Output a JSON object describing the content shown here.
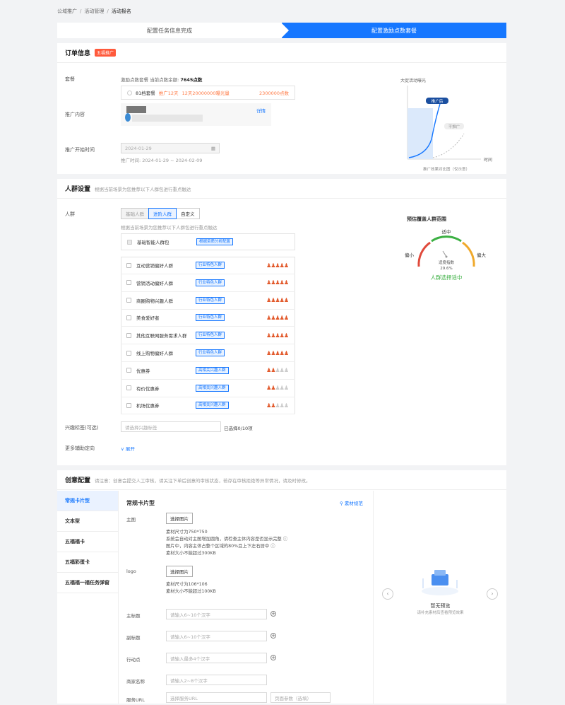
{
  "breadcrumb": {
    "items": [
      "公域推广",
      "活动管理",
      "活动报名"
    ],
    "sep": "/"
  },
  "steps": {
    "step1": "配置任务信息完成",
    "step2": "配置激励点数套餐"
  },
  "order": {
    "title": "订单信息",
    "badge": "五福推广",
    "package_label": "套餐",
    "package_info": "激励点数套餐  当前点数余额:",
    "balance": "7645点数",
    "package_line": {
      "price": "81档套餐",
      "promo": "推广12天",
      "exposure": "12天20000000曝光量",
      "points": "2300000点数"
    },
    "content_label": "推广内容",
    "detail_link": "详情",
    "start_label": "推广开始时间",
    "start_date": "2024-01-29",
    "promo_time": "推广时间: 2024-01-29 ~ 2024-02-09",
    "chart_ylabel": "大促活动曝光",
    "chart_tag1": "推广后",
    "chart_tag2": "平推广",
    "chart_xlabel": "时间",
    "chart_caption": "推广效果对比图（仅示意）"
  },
  "crowd": {
    "title": "人群设置",
    "subtitle": "根据当前场景为您推荐以下人群包进行重点触达",
    "label": "人群",
    "tabs": [
      "基础人群",
      "进阶人群",
      "自定义"
    ],
    "hint": "根据当前场景为您推荐以下人群包进行重点触达",
    "base": {
      "name": "基础智能人群包",
      "tag": "根据资质分析配置"
    },
    "items": [
      {
        "name": "互动营销偏好人群",
        "tag": "行业特色人群",
        "level": 5
      },
      {
        "name": "营销活动偏好人群",
        "tag": "行业特色人群",
        "level": 5
      },
      {
        "name": "商圈购物兴趣人群",
        "tag": "行业特色人群",
        "level": 5
      },
      {
        "name": "美食爱好者",
        "tag": "行业特色人群",
        "level": 5
      },
      {
        "name": "其他互联网服务需求人群",
        "tag": "行业特色人群",
        "level": 5
      },
      {
        "name": "线上购物偏好人群",
        "tag": "行业特色人群",
        "level": 5
      },
      {
        "name": "优惠券",
        "tag": "高相关兴趣人群",
        "level": 2
      },
      {
        "name": "有价优惠券",
        "tag": "高相关兴趣人群",
        "level": 1.5
      },
      {
        "name": "机场优惠券",
        "tag": "高相关兴趣人群",
        "level": 1.5
      }
    ],
    "interest_label": "兴趣标签(可选)",
    "interest_placeholder": "请选择兴趣标签",
    "interest_count": "已选择0/10项",
    "more_label": "更多辅助定向",
    "expand": "展开",
    "gauge": {
      "title": "预估覆盖人群范围",
      "top": "适中",
      "left": "偏小",
      "right": "偏大",
      "index_label": "适度指数",
      "index_value": "29.6%",
      "result": "人群选择适中",
      "colors": {
        "left": "#e04a3c",
        "mid": "#3cb043",
        "right": "#f0a92b"
      }
    }
  },
  "creative": {
    "title": "创意配置",
    "notice": "请注意：创意会提交人工审核，请关注下单后创意的审核状态，若存在审核拒绝等异常情况，请及时修改。",
    "nav": [
      "常规卡片型",
      "文本型",
      "五福福卡",
      "五福彩蛋卡",
      "五福福一福任务弹窗"
    ],
    "form_title": "常规卡片型",
    "spec_link": "素材规范",
    "main_image_label": "主图",
    "select_btn": "选择图片",
    "main_tips": [
      "素材尺寸为750*750",
      "系统会自动对主图增加圆角，请检查主体内容是否显示完整 ⓘ",
      "图片中，内容主体占整个区域的80%且上下左右居中 ⓘ",
      "素材大小不能超过300KB"
    ],
    "logo_label": "logo",
    "logo_tips": [
      "素材尺寸为106*106",
      "素材大小不能超过100KB"
    ],
    "fields": [
      {
        "label": "主标题",
        "placeholder": "请输入6~10个汉字"
      },
      {
        "label": "副标题",
        "placeholder": "请输入6~10个汉字"
      },
      {
        "label": "行动点",
        "placeholder": "请输入最多4个汉字"
      },
      {
        "label": "商家名称",
        "placeholder": "请输入2~8个汉字"
      }
    ],
    "url_label": "服务URL",
    "url_placeholder": "选择服务URL",
    "url_param_placeholder": "页面参数（选填）",
    "preview_title": "暂无预览",
    "preview_sub": "请补充素材后查看预览效果"
  }
}
